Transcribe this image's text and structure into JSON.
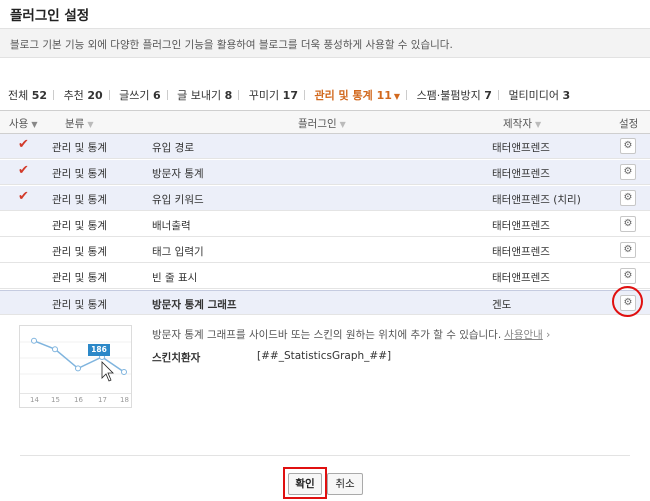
{
  "page": {
    "title": "플러그인 설정",
    "description": "블로그 기본 기능 외에 다양한 플러그인 기능을 활용하여 블로그를 더욱 풍성하게 사용할 수 있습니다."
  },
  "tabs": [
    {
      "label": "전체",
      "count": "52"
    },
    {
      "label": "추천",
      "count": "20"
    },
    {
      "label": "글쓰기",
      "count": "6"
    },
    {
      "label": "글 보내기",
      "count": "8"
    },
    {
      "label": "꾸미기",
      "count": "17"
    },
    {
      "label": "관리 및 통계",
      "count": "11",
      "active": true
    },
    {
      "label": "스팸·불펌방지",
      "count": "7"
    },
    {
      "label": "멀티미디어",
      "count": "3"
    }
  ],
  "table": {
    "headers": {
      "use": "사용",
      "category": "분류",
      "plugin": "플러그인",
      "author": "제작자",
      "settings": "설정"
    },
    "rows": [
      {
        "enabled": true,
        "category": "관리 및 통계",
        "plugin": "유입 경로",
        "author": "태터앤프렌즈"
      },
      {
        "enabled": true,
        "category": "관리 및 통계",
        "plugin": "방문자 통계",
        "author": "태터앤프렌즈"
      },
      {
        "enabled": true,
        "category": "관리 및 통계",
        "plugin": "유입 키워드",
        "author": "태터앤프렌즈 (치리)"
      },
      {
        "enabled": false,
        "category": "관리 및 통계",
        "plugin": "배너출력",
        "author": "태터앤프렌즈"
      },
      {
        "enabled": false,
        "category": "관리 및 통계",
        "plugin": "태그 입력기",
        "author": "태터앤프렌즈"
      },
      {
        "enabled": false,
        "category": "관리 및 통계",
        "plugin": "빈 줄 표시",
        "author": "태터앤프렌즈"
      },
      {
        "enabled": false,
        "category": "관리 및 통계",
        "plugin": "방문자 통계 그래프",
        "author": "겐도",
        "selected": true
      }
    ]
  },
  "detail": {
    "description": "방문자 통계 그래프를 사이드바 또는 스킨의 원하는 위치에 추가 할 수 있습니다.",
    "guide_link": "사용안내",
    "guide_arrow": "›",
    "substitute_label": "스킨치환자",
    "substitute_code": "[##_StatisticsGraph_##]",
    "thumbnail": {
      "badge": "186",
      "ticks": [
        "14",
        "15",
        "16",
        "17",
        "18"
      ],
      "series": [
        82,
        68,
        36,
        55,
        30
      ],
      "ylim": [
        0,
        100
      ]
    }
  },
  "buttons": {
    "ok": "확인",
    "cancel": "취소"
  },
  "icons": {
    "check": "✔",
    "gear": "⚙",
    "caret": "▼",
    "cursor": "cursor-arrow-icon"
  },
  "colors": {
    "active_tab": "#d2691e",
    "check": "#d23a2a",
    "highlight": "#e01010",
    "badge": "#2c88c8"
  }
}
